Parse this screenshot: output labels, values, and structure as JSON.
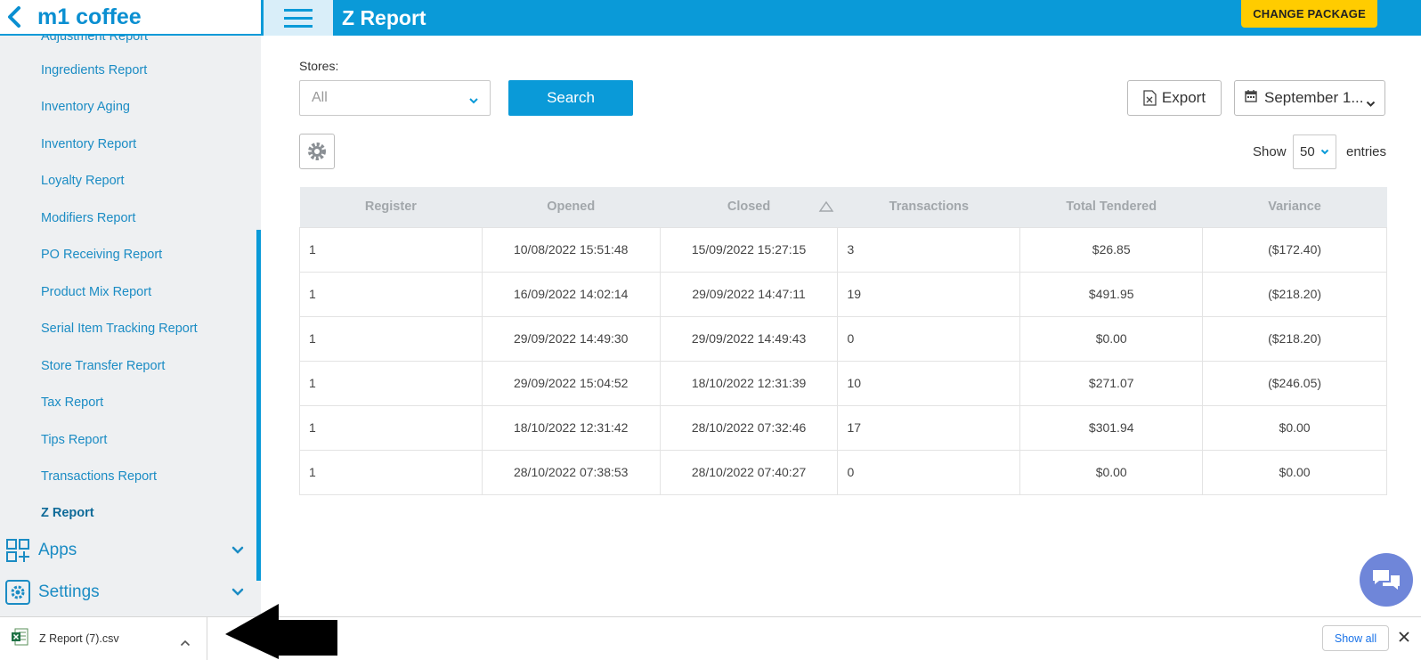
{
  "brand": "m1 coffee",
  "page_title": "Z Report",
  "change_package": "CHANGE PACKAGE",
  "sidebar": {
    "partial_item": "Adjustment Report",
    "items": [
      "Ingredients Report",
      "Inventory Aging",
      "Inventory Report",
      "Loyalty Report",
      "Modifiers Report",
      "PO Receiving Report",
      "Product Mix Report",
      "Serial Item Tracking Report",
      "Store Transfer Report",
      "Tax Report",
      "Tips Report",
      "Transactions Report",
      "Z Report"
    ],
    "active_item": "Z Report",
    "sections": {
      "apps": "Apps",
      "settings": "Settings"
    }
  },
  "filters": {
    "stores_label": "Stores:",
    "stores_value": "All",
    "search_label": "Search",
    "export_label": "Export",
    "date_value": "September 1..."
  },
  "entries": {
    "show": "Show",
    "value": "50",
    "suffix": "entries"
  },
  "table": {
    "columns": [
      "Register",
      "Opened",
      "Closed",
      "Transactions",
      "Total Tendered",
      "Variance"
    ],
    "rows": [
      [
        "1",
        "10/08/2022 15:51:48",
        "15/09/2022 15:27:15",
        "3",
        "$26.85",
        "($172.40)"
      ],
      [
        "1",
        "16/09/2022 14:02:14",
        "29/09/2022 14:47:11",
        "19",
        "$491.95",
        "($218.20)"
      ],
      [
        "1",
        "29/09/2022 14:49:30",
        "29/09/2022 14:49:43",
        "0",
        "$0.00",
        "($218.20)"
      ],
      [
        "1",
        "29/09/2022 15:04:52",
        "18/10/2022 12:31:39",
        "10",
        "$271.07",
        "($246.05)"
      ],
      [
        "1",
        "18/10/2022 12:31:42",
        "28/10/2022 07:32:46",
        "17",
        "$301.94",
        "$0.00"
      ],
      [
        "1",
        "28/10/2022 07:38:53",
        "28/10/2022 07:40:27",
        "0",
        "$0.00",
        "$0.00"
      ]
    ]
  },
  "download_bar": {
    "file_name": "Z Report (7).csv",
    "show_all": "Show all"
  },
  "colors": {
    "accent": "#0a9ad8",
    "package_button": "#ffcc00",
    "chat": "#6f86d9"
  }
}
